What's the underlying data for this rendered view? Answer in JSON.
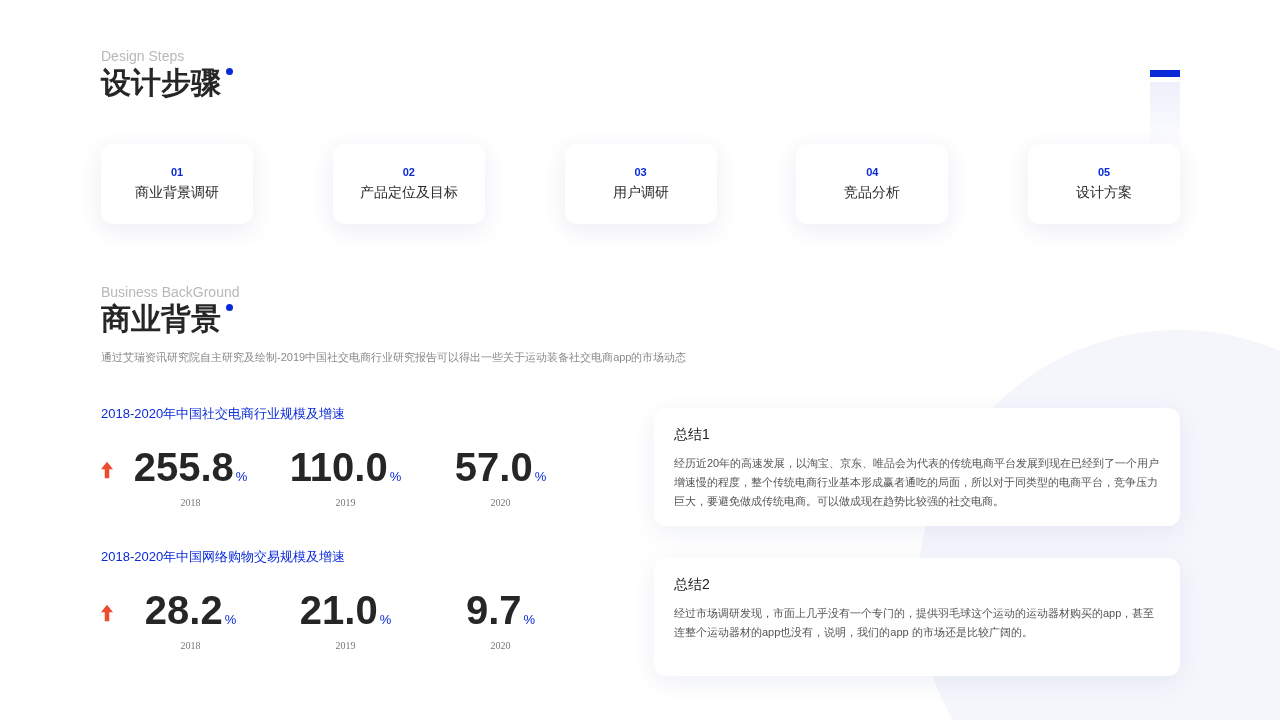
{
  "design_steps": {
    "subtitle": "Design Steps",
    "title": "设计步骤",
    "steps": [
      {
        "number": "01",
        "label": "商业背景调研"
      },
      {
        "number": "02",
        "label": "产品定位及目标"
      },
      {
        "number": "03",
        "label": "用户调研"
      },
      {
        "number": "04",
        "label": "竞品分析"
      },
      {
        "number": "05",
        "label": "设计方案"
      }
    ]
  },
  "business_background": {
    "subtitle": "Business BackGround",
    "title": "商业背景",
    "description": "通过艾瑞资讯研究院自主研究及绘制-2019中国社交电商行业研究报告可以得出一些关于运动装备社交电商app的市场动态",
    "stat_groups": [
      {
        "heading": "2018-2020年中国社交电商行业规模及增速",
        "rising": true,
        "items": [
          {
            "value": "255.8",
            "unit": "%",
            "year": "2018"
          },
          {
            "value": "110.0",
            "unit": "%",
            "year": "2019"
          },
          {
            "value": "57.0",
            "unit": "%",
            "year": "2020"
          }
        ]
      },
      {
        "heading": "2018-2020年中国网络购物交易规模及增速",
        "rising": true,
        "items": [
          {
            "value": "28.2",
            "unit": "%",
            "year": "2018"
          },
          {
            "value": "21.0",
            "unit": "%",
            "year": "2019"
          },
          {
            "value": "9.7",
            "unit": "%",
            "year": "2020"
          }
        ]
      }
    ],
    "summaries": [
      {
        "title": "总结1",
        "text": "经历近20年的高速发展，以淘宝、京东、唯品会为代表的传统电商平台发展到现在已经到了一个用户增速慢的程度，整个传统电商行业基本形成赢者通吃的局面，所以对于同类型的电商平台，竞争压力巨大，要避免做成传统电商。可以做成现在趋势比较强的社交电商。"
      },
      {
        "title": "总结2",
        "text": "经过市场调研发现，市面上几乎没有一个专门的，提供羽毛球这个运动的运动器材购买的app，甚至连整个运动器材的app也没有，说明，我们的app 的市场还是比较广阔的。"
      }
    ]
  }
}
